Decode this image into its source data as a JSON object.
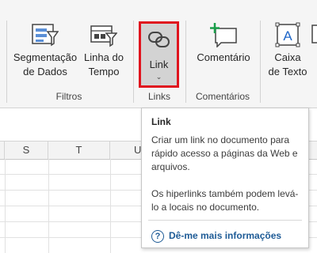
{
  "ribbon": {
    "buttons": {
      "segmentacao": {
        "line1": "Segmentação",
        "line2": "de Dados"
      },
      "linha_tempo": {
        "line1": "Linha do",
        "line2": "Tempo"
      },
      "link": {
        "label": "Link",
        "chevron": "⌄"
      },
      "comentario": {
        "label": "Comentário"
      },
      "caixa_texto": {
        "line1": "Caixa",
        "line2": "de Texto"
      }
    },
    "groups": {
      "filtros": "Filtros",
      "links": "Links",
      "comentarios": "Comentários"
    },
    "highlight_color": "#e0141e"
  },
  "sheet": {
    "columns": [
      "S",
      "T",
      "U"
    ]
  },
  "tooltip": {
    "title": "Link",
    "description": "Criar um link no documento para rápido acesso a páginas da Web e arquivos.",
    "extra": "Os hiperlinks também podem levá-lo a locais no documento.",
    "help_icon": "?",
    "more_link": "Dê-me mais informações",
    "link_color": "#1e5b96"
  }
}
